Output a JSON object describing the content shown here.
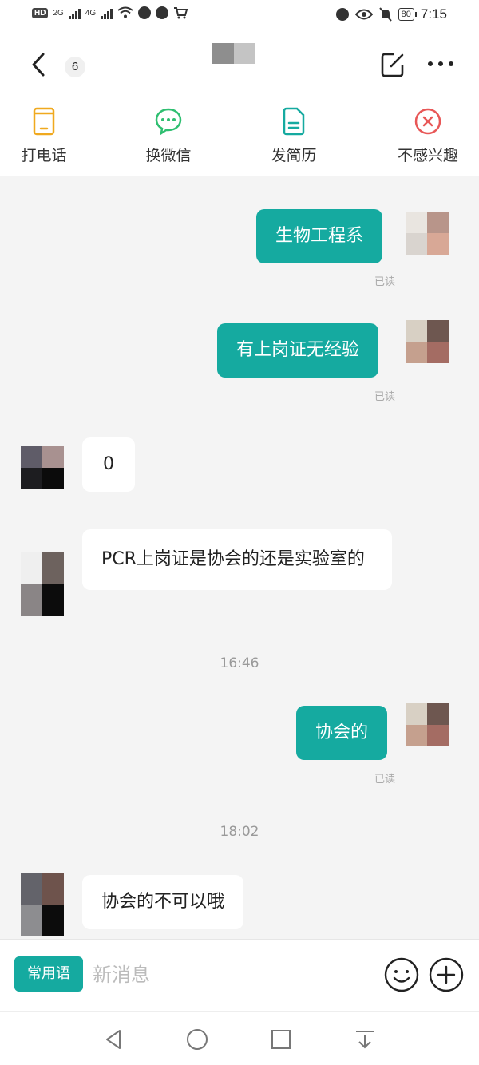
{
  "status_bar": {
    "hd": "HD",
    "sim1": "2G",
    "sim2": "4G",
    "battery": "80",
    "time": "7:15"
  },
  "header": {
    "unread_count": "6",
    "back_icon": "chevron-left-icon",
    "edit_icon": "edit-icon",
    "more_icon": "more-dots-icon"
  },
  "actions": [
    {
      "label": "打电话",
      "icon": "phone-icon",
      "color": "#f0a91f"
    },
    {
      "label": "换微信",
      "icon": "wechat-icon",
      "color": "#2fbf71"
    },
    {
      "label": "发简历",
      "icon": "resume-icon",
      "color": "#15aaa0"
    },
    {
      "label": "不感兴趣",
      "icon": "close-circle-icon",
      "color": "#e85757"
    }
  ],
  "messages": [
    {
      "type": "out",
      "text": "生物工程系",
      "read": "已读"
    },
    {
      "type": "out",
      "text": "有上岗证无经验",
      "read": "已读"
    },
    {
      "type": "in",
      "text": "0"
    },
    {
      "type": "in",
      "text": "PCR上岗证是协会的还是实验室的"
    },
    {
      "type": "time",
      "text": "16:46"
    },
    {
      "type": "out",
      "text": "协会的",
      "read": "已读"
    },
    {
      "type": "time",
      "text": "18:02"
    },
    {
      "type": "in",
      "text": "协会的不可以哦"
    }
  ],
  "input_bar": {
    "phrases_label": "常用语",
    "placeholder": "新消息",
    "emoji_icon": "emoji-icon",
    "plus_icon": "plus-icon"
  },
  "nav_bar": {
    "back_icon": "nav-back-icon",
    "home_icon": "nav-home-icon",
    "recents_icon": "nav-recents-icon",
    "dropdown_icon": "nav-dropdown-icon"
  },
  "colors": {
    "accent": "#15aaa0",
    "bubble_in": "#ffffff",
    "background": "#f4f4f4"
  }
}
